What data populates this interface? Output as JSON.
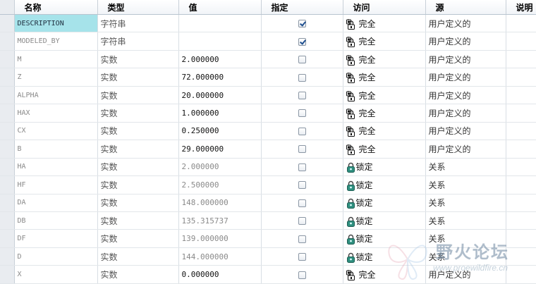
{
  "columns": [
    "名称",
    "类型",
    "值",
    "指定",
    "访问",
    "源",
    "说明"
  ],
  "rows": [
    {
      "name": "DESCRIPTION",
      "type": "字符串",
      "value": "",
      "designated": true,
      "access": "完全",
      "access_icon": "unlock-icon",
      "source": "用户定义的",
      "note": ""
    },
    {
      "name": "MODELED_BY",
      "type": "字符串",
      "value": "",
      "designated": true,
      "access": "完全",
      "access_icon": "unlock-icon",
      "source": "用户定义的",
      "note": ""
    },
    {
      "name": "M",
      "type": "实数",
      "value": "2.000000",
      "designated": false,
      "access": "完全",
      "access_icon": "unlock-icon",
      "source": "用户定义的",
      "note": ""
    },
    {
      "name": "Z",
      "type": "实数",
      "value": "72.000000",
      "designated": false,
      "access": "完全",
      "access_icon": "unlock-icon",
      "source": "用户定义的",
      "note": ""
    },
    {
      "name": "ALPHA",
      "type": "实数",
      "value": "20.000000",
      "designated": false,
      "access": "完全",
      "access_icon": "unlock-icon",
      "source": "用户定义的",
      "note": ""
    },
    {
      "name": "HAX",
      "type": "实数",
      "value": "1.000000",
      "designated": false,
      "access": "完全",
      "access_icon": "unlock-icon",
      "source": "用户定义的",
      "note": ""
    },
    {
      "name": "CX",
      "type": "实数",
      "value": "0.250000",
      "designated": false,
      "access": "完全",
      "access_icon": "unlock-icon",
      "source": "用户定义的",
      "note": ""
    },
    {
      "name": "B",
      "type": "实数",
      "value": "29.000000",
      "designated": false,
      "access": "完全",
      "access_icon": "unlock-icon",
      "source": "用户定义的",
      "note": ""
    },
    {
      "name": "HA",
      "type": "实数",
      "value": "2.000000",
      "designated": false,
      "access": "锁定",
      "access_icon": "lock-icon",
      "source": "关系",
      "note": ""
    },
    {
      "name": "HF",
      "type": "实数",
      "value": "2.500000",
      "designated": false,
      "access": "锁定",
      "access_icon": "lock-icon",
      "source": "关系",
      "note": ""
    },
    {
      "name": "DA",
      "type": "实数",
      "value": "148.000000",
      "designated": false,
      "access": "锁定",
      "access_icon": "lock-icon",
      "source": "关系",
      "note": ""
    },
    {
      "name": "DB",
      "type": "实数",
      "value": "135.315737",
      "designated": false,
      "access": "锁定",
      "access_icon": "lock-icon",
      "source": "关系",
      "note": ""
    },
    {
      "name": "DF",
      "type": "实数",
      "value": "139.000000",
      "designated": false,
      "access": "锁定",
      "access_icon": "lock-icon",
      "source": "关系",
      "note": ""
    },
    {
      "name": "D",
      "type": "实数",
      "value": "144.000000",
      "designated": false,
      "access": "锁定",
      "access_icon": "lock-icon",
      "source": "关系",
      "note": ""
    },
    {
      "name": "X",
      "type": "实数",
      "value": "0.000000",
      "designated": false,
      "access": "完全",
      "access_icon": "unlock-icon",
      "source": "用户定义的",
      "note": ""
    }
  ],
  "selected_row": 0,
  "colors": {
    "selection": "#a6e3ea",
    "lock": "#2f8f7f",
    "checkmark": "#1f4f8f",
    "header_border": "#b8c4d0"
  },
  "watermark": {
    "icon": "butterfly-logo-icon",
    "title": "野火论坛",
    "url": "www.proewildfire.cn"
  }
}
